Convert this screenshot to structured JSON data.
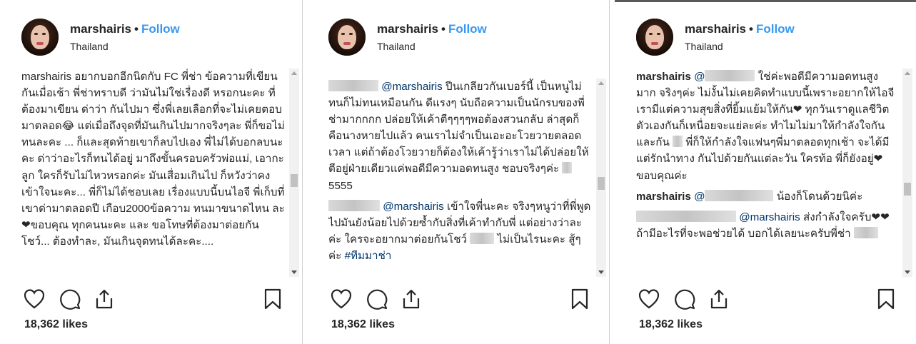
{
  "posts": [
    {
      "username": "marshairis",
      "separator": "•",
      "follow": "Follow",
      "location": "Thailand",
      "comments": [
        "marshairis อยากบอกอีกนิดกับ FC พี่ช่า ข้อความที่เขียนกันเมื่อเช้า พี่ช่าทราบดี ว่ามันไม่ใช่เรื่องดี หรอกนะคะ ที่ต้องมาเขียน ด่าว่า กันไปมา ซึ่งพี่เลยเลือกที่จะไม่เคยตอบมาตลอด😂 แต่เมื่อถึงจุดที่มันเกินไปมากจริงๆละ พี่ก็ขอไม่ทนละคะ ... ก็และสุดท้ายเขาก็ลบไปเอง พี่ไม่ได้บอกลบนะ คะ ด่าว่าอะไรก็ทนได้อยู่ มาถึงขั้นครอบครัวพ่อแม่, เอากะลูก ใครก็รับไม่ไหวหรอกค่ะ มันเสื่อมเกินไป ก็หวังว่าคงเข้าใจนะคะ... พี่ก็ไม่ได้ชอบเลย เรื่องแบบนี้บนไอจี พี่เก็บที่เขาด่ามาตลอดปี เกือบ2000ข้อความ ทนมาขนาดไหน ละ ❤ขอบคุณ ทุกคนนะคะ และ ขอโทษที่ต้องมาต่อยกันโชว์... ต้องทำละ, มันเกินจุดทนได้ละคะ...."
      ],
      "likes": "18,362 likes"
    },
    {
      "username": "marshairis",
      "separator": "•",
      "follow": "Follow",
      "location": "Thailand",
      "comments": [
        {
          "mention": "@marshairis",
          "text": "ปีนเกลียวกันเบอร์นี้ เป็นหนูไม่ทนก็ไม่ทนเหมือนกัน ดีแรงๆ นับถือความเป็นนักรบของพี่ช่ามากกกก ปล่อยให้เค้าตีๆๆๆๆพอต้องสวนกลับ ล่าสุดก็คือนางหายไปแล้ว คนเราไม่จำเป็นเอะอะโวยวายตลอดเวลา แต่ถ้าต้องโวยวายก็ต้องให้เค้ารู้ว่าเราไม่ได้ปล่อยให้ตีอยู่ฝ่ายเดียวแค่พอดีมีความอดทนสูง ชอบจริงๆค่ะ",
          "tail": "5555"
        },
        {
          "mention": "@marshairis",
          "text": "เข้าใจพี่นะคะ จริงๆหนูว่าที่พี่พูดไปมันยังน้อยไปด้วยซ้ำกับสิ่งที่เค้าทำกับพี่ แต่อย่างว่าละค่ะ ใครจะอยากมาต่อยกันโชว์",
          "text2": "ไม่เป็นไรนะคะ สู้ๆค่ะ",
          "hashtag": "#ทีมมาช่า"
        }
      ],
      "likes": "18,362 likes"
    },
    {
      "username": "marshairis",
      "separator": "•",
      "follow": "Follow",
      "location": "Thailand",
      "comments": [
        {
          "user": "marshairis",
          "mention": "@",
          "text": "ใช่ค่ะพอดีมีความอดทนสูงมาก จริงๆค่ะ ไม่งั้นไม่เคยคิดทำแบบนี้เพราะอยากให้ไอจีเรามีแต่ความสุขสิ่งที่ยิ้มแย้มให้กัน❤ ทุกวันเราดูแลชีวิตตัวเองกันก็เหนื่อยจะแย่ละค่ะ ทำไมไม่มาให้กำลังใจกันและกัน",
          "text2": "พี่ก็ให้กำลังใจแฟนๆพี่มาตลอดทุกเช้า จะได้มีแต่รักนำทาง กันไปด้วยกันแต่ละวัน ใครท้อ พี่ก็ยังอยู่❤ ขอบคุณค่ะ"
        },
        {
          "user": "marshairis",
          "mention": "@",
          "text": "น้องก็โดนด้วยนิค่ะ"
        },
        {
          "mention": "@marshairis",
          "text": "ส่งกำลังใจครับ❤❤ ถ้ามีอะไรที่จะพอช่วยได้ บอกได้เลยนะครับพี่ช่า"
        }
      ],
      "likes": "18,362 likes"
    }
  ]
}
